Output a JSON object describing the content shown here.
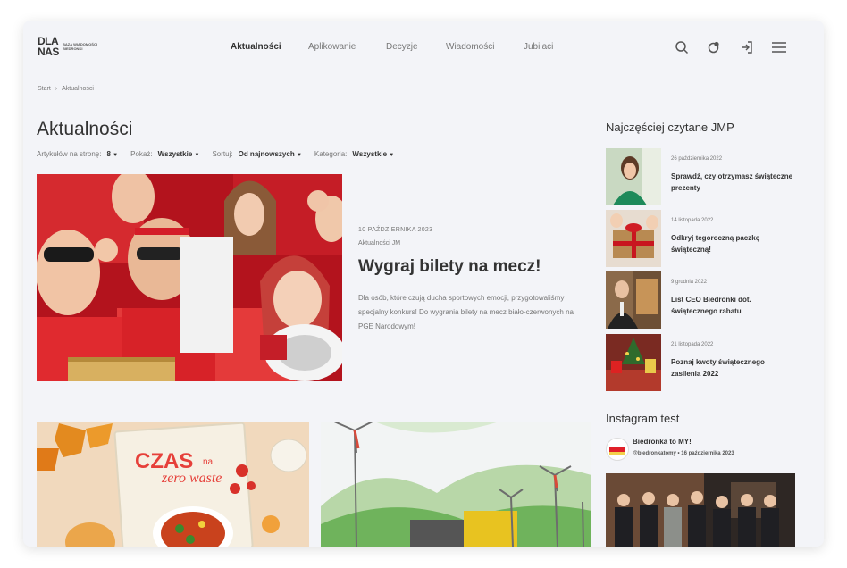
{
  "logo": {
    "line1": "DLA",
    "line2": "NAS",
    "tagline1": "BAZA WIADOMOŚCI",
    "tagline2": "BIEDRONKI"
  },
  "nav": {
    "items": [
      "Aktualności",
      "Aplikowanie",
      "Decyzje",
      "Wiadomości",
      "Jubilaci"
    ],
    "active": "Aktualności"
  },
  "header_icons": [
    "search-icon",
    "shop-icon",
    "login-icon",
    "menu-icon"
  ],
  "breadcrumb": [
    "Start",
    "Aktualności"
  ],
  "page_title": "Aktualności",
  "filters": {
    "per_page_label": "Artykułów na stronę:",
    "per_page_value": "8",
    "show_label": "Pokaż:",
    "show_value": "Wszystkie",
    "sort_label": "Sortuj:",
    "sort_value": "Od najnowszych",
    "category_label": "Kategoria:",
    "category_value": "Wszystkie"
  },
  "featured": {
    "date": "10 PAŹDZIERNIKA 2023",
    "category": "Aktualności JM",
    "title": "Wygraj bilety na mecz!",
    "excerpt": "Dla osób, które czują ducha sportowych emocji, przygotowaliśmy specjalny konkurs! Do wygrania bilety na mecz biało-czerwonych na PGE Narodowym!"
  },
  "cards": [
    {
      "image": "Czas na zero waste cookbook",
      "text_big": "CZAS",
      "text_small": "na",
      "text_line2": "zero waste"
    },
    {
      "image": "Wind turbines illustration"
    }
  ],
  "sidebar": {
    "heading": "Najczęściej czytane JMP",
    "items": [
      {
        "date": "26 października 2022",
        "title": "Sprawdź, czy otrzymasz świąteczne prezenty"
      },
      {
        "date": "14 listopada 2022",
        "title": "Odkryj tegoroczną paczkę świąteczną!"
      },
      {
        "date": "9 grudnia 2022",
        "title": "List CEO Biedronki dot. świątecznego rabatu"
      },
      {
        "date": "21 listopada 2022",
        "title": "Poznaj kwoty świątecznego zasilenia 2022"
      }
    ]
  },
  "instagram": {
    "heading": "Instagram test",
    "account_name": "Biedronka to MY!",
    "handle_date": "@biedronkatomy • 16 października 2023"
  },
  "colors": {
    "accent": "#e0202a",
    "text": "#333333",
    "muted": "#777777",
    "background": "#f3f4f8"
  }
}
